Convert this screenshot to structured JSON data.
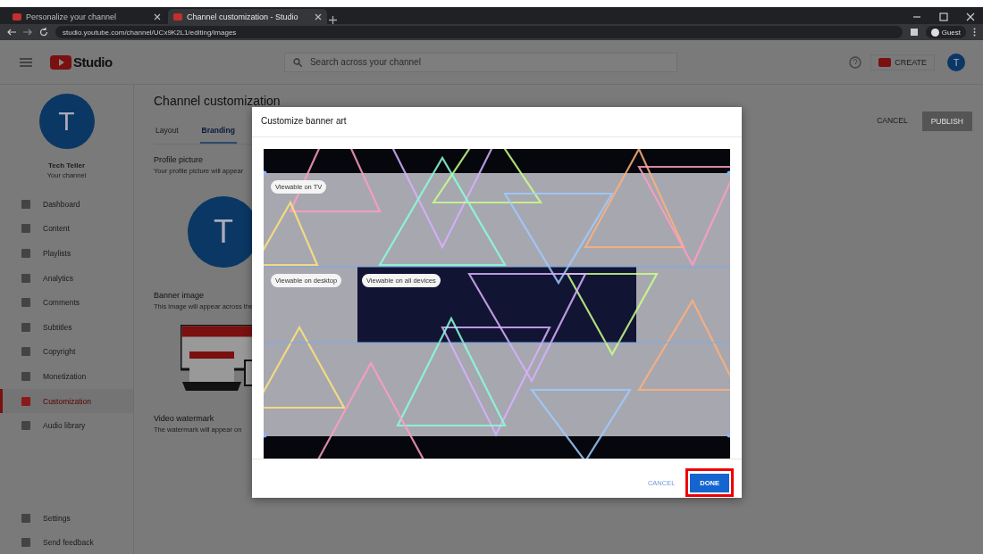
{
  "browser": {
    "tabs": [
      {
        "title": "Personalize your channel",
        "selected": false
      },
      {
        "title": "Channel customization - Studio",
        "selected": true
      }
    ],
    "address": "studio.youtube.com/channel/UCx9K2L1/editing/images",
    "profile": "Guest"
  },
  "header": {
    "logo": "Studio",
    "search": {
      "placeholder": "Search across your channel"
    },
    "create": "CREATE",
    "avatar": "T"
  },
  "sidebar": {
    "avatar": "T",
    "channel_name": "Tech Teller",
    "channel_subtitle": "Your channel",
    "items": [
      {
        "label": "Dashboard",
        "selected": false
      },
      {
        "label": "Content",
        "selected": false
      },
      {
        "label": "Playlists",
        "selected": false
      },
      {
        "label": "Analytics",
        "selected": false
      },
      {
        "label": "Comments",
        "selected": false
      },
      {
        "label": "Subtitles",
        "selected": false
      },
      {
        "label": "Copyright",
        "selected": false
      },
      {
        "label": "Monetization",
        "selected": false
      },
      {
        "label": "Customization",
        "selected": true
      },
      {
        "label": "Audio library",
        "selected": false
      }
    ],
    "footer": [
      {
        "label": "Settings"
      },
      {
        "label": "Send feedback"
      }
    ]
  },
  "main": {
    "title": "Channel customization",
    "tabs": [
      {
        "label": "Layout",
        "selected": false
      },
      {
        "label": "Branding",
        "selected": true
      }
    ],
    "actions": {
      "cancel": "CANCEL",
      "publish": "PUBLISH"
    },
    "sections": [
      {
        "title": "Profile picture",
        "description": "Your profile picture will appear",
        "kind": "avatar",
        "avatar": "T"
      },
      {
        "title": "Banner image",
        "description": "This image will appear across the",
        "kind": "devices"
      },
      {
        "title": "Video watermark",
        "description": "The watermark will appear on",
        "kind": "empty"
      }
    ]
  },
  "dialog": {
    "title": "Customize banner art",
    "labels": [
      {
        "text": "Viewable on TV",
        "kind": "tv"
      },
      {
        "text": "Viewable on desktop",
        "kind": "desktop"
      },
      {
        "text": "Viewable on all devices",
        "kind": "all"
      }
    ],
    "cancel": "CANCEL",
    "done": "DONE",
    "done_highlighted": true
  }
}
